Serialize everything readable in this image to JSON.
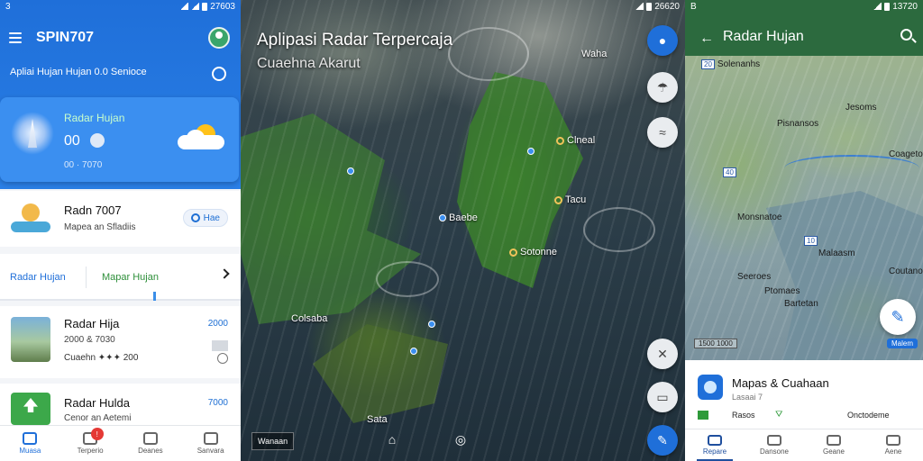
{
  "status_left": {
    "carrier": "3",
    "time": "27603"
  },
  "status_mid": {
    "time": "26620"
  },
  "status_right": {
    "carrier": "B",
    "time": "13720"
  },
  "left_app": {
    "title": "SPIN707",
    "subtitle": "Apliai Hujan Hujan 0.0 Senioce",
    "card": {
      "label": "Radar Hujan",
      "value": "00",
      "time": "00 · 7070"
    },
    "row": {
      "title": "Radn 7007",
      "subtitle": "Mapea an Sfladiis",
      "chip": "Hae"
    },
    "tabs": {
      "tab1": "Radar Hujan",
      "tab2": "Mapar Hujan"
    },
    "items": [
      {
        "title": "Radar Hija",
        "line1": "2000 & 7030",
        "line2": "Cuaehn ✦✦✦ 200",
        "tag": "2000"
      },
      {
        "title": "Radar Hulda",
        "line1": "Cenor an Aetemi",
        "tag": "7000"
      }
    ],
    "nav": [
      {
        "label": "Muasa",
        "icon": "home-icon"
      },
      {
        "label": "Terperio",
        "icon": "calendar-icon",
        "badge": "!"
      },
      {
        "label": "Deanes",
        "icon": "cloud-icon"
      },
      {
        "label": "Sanvara",
        "icon": "profile-icon"
      }
    ]
  },
  "map": {
    "heading": "Aplipasi Radar Terpercaja",
    "subheading": "Cuaehna Akarut",
    "places": [
      "Waha",
      "Clneal",
      "Baebe",
      "Tacu",
      "Sotonne",
      "Colsaba",
      "Sata"
    ],
    "scale": "Wanaan"
  },
  "right_app": {
    "title": "Radar Hujan",
    "map_labels": [
      "Solenanhs",
      "Jesoms",
      "Pisnansos",
      "Coagetoe",
      "Monsnatoe",
      "Malaasm",
      "Coutanoe",
      "Seeroes",
      "Ptomaes",
      "Bartetan"
    ],
    "scale": "1500 1000",
    "pill": "Malem",
    "sheet": {
      "name": "Mapas & Cuahaan",
      "sub": "Lasaai 7",
      "lab1": "Rasos",
      "lab2": "⛛",
      "lab3": "Onctodeme"
    },
    "nav": [
      {
        "label": "Repare",
        "icon": "radar-icon"
      },
      {
        "label": "Dansone",
        "icon": "tools-icon"
      },
      {
        "label": "Geane",
        "icon": "compass-icon"
      },
      {
        "label": "Aene",
        "icon": "list-icon"
      }
    ]
  },
  "colors": {
    "primary_blue": "#1f6fd9",
    "green_bar": "#2c6a3e"
  }
}
